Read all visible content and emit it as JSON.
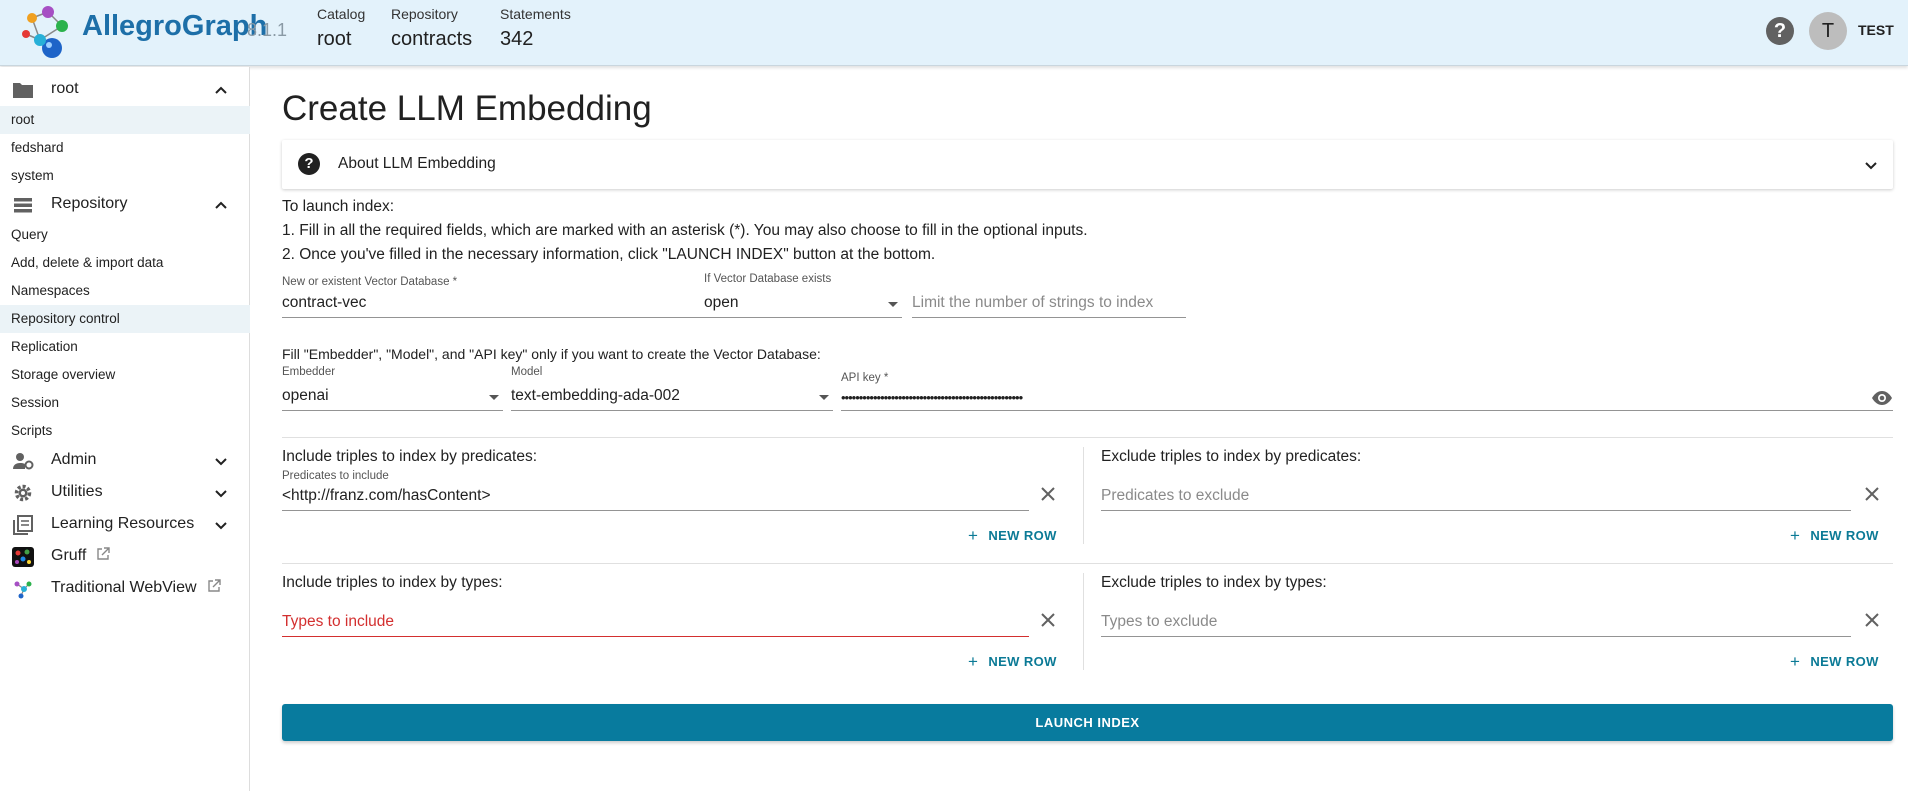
{
  "header": {
    "brand": "AllegroGraph",
    "version": "8.1.1",
    "catalog_label": "Catalog",
    "catalog_value": "root",
    "repository_label": "Repository",
    "repository_value": "contracts",
    "statements_label": "Statements",
    "statements_value": "342",
    "help": "?",
    "avatar_initial": "T",
    "username": "TEST"
  },
  "sidebar": {
    "catalog_section": "root",
    "catalogs": [
      "root",
      "fedshard",
      "system"
    ],
    "repository_section": "Repository",
    "repository_items": [
      "Query",
      "Add, delete & import data",
      "Namespaces",
      "Repository control",
      "Replication",
      "Storage overview",
      "Session",
      "Scripts"
    ],
    "admin": "Admin",
    "utilities": "Utilities",
    "learning": "Learning Resources",
    "gruff": "Gruff",
    "webview": "Traditional WebView"
  },
  "main": {
    "title": "Create LLM Embedding",
    "about": "About LLM Embedding",
    "instr_title": "To launch index:",
    "instr_1": "1. Fill in all the required fields, which are marked with an asterisk (*). You may also choose to fill in the optional inputs.",
    "instr_2": "2. Once you've filled in the necessary information, click \"LAUNCH INDEX\" button at the bottom.",
    "vdb_label": "New or existent Vector Database *",
    "vdb_value": "contract-vec",
    "exists_label": "If Vector Database exists",
    "exists_value": "open",
    "limit_placeholder": "Limit the number of strings to index",
    "fill_note": "Fill \"Embedder\", \"Model\", and \"API key\" only if you want to create the Vector Database:",
    "embedder_label": "Embedder",
    "embedder_value": "openai",
    "model_label": "Model",
    "model_value": "text-embedding-ada-002",
    "apikey_label": "API key *",
    "apikey_value": "•••••••••••••••••••••••••••••••••••••••••••••••••••",
    "include_pred_title": "Include triples to index by predicates:",
    "include_pred_label": "Predicates to include",
    "include_pred_value": "<http://franz.com/hasContent>",
    "exclude_pred_title": "Exclude triples to index by predicates:",
    "exclude_pred_placeholder": "Predicates to exclude",
    "include_types_title": "Include triples to index by types:",
    "include_types_placeholder": "Types to include",
    "exclude_types_title": "Exclude triples to index by types:",
    "exclude_types_placeholder": "Types to exclude",
    "new_row": "NEW ROW",
    "launch": "LAUNCH INDEX"
  },
  "colors": {
    "header_bg": "#e3f2fb",
    "accent": "#087b9e",
    "error": "#d32f2f"
  }
}
